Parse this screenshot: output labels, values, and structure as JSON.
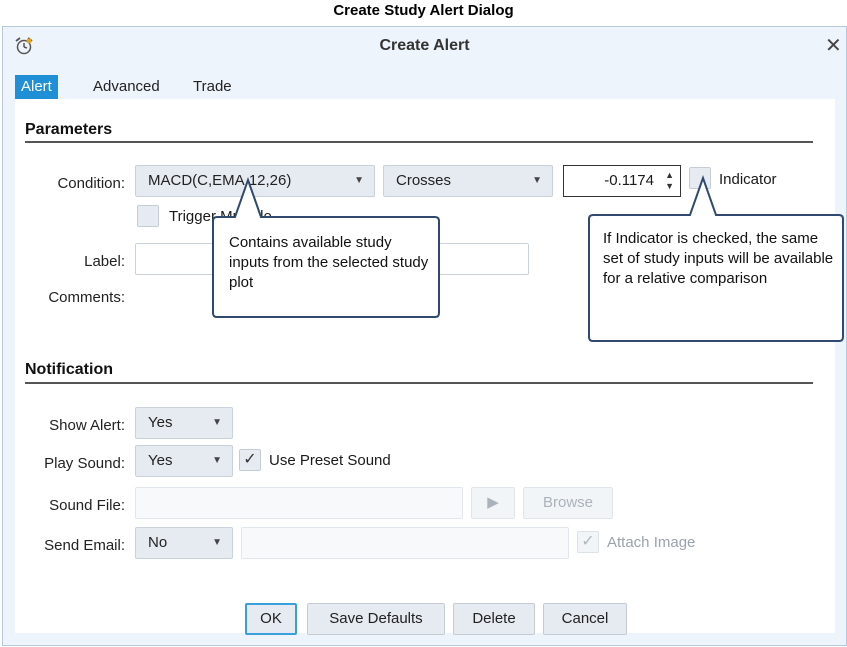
{
  "caption": "Create Study Alert Dialog",
  "window": {
    "title": "Create Alert",
    "close_glyph": "✕",
    "icon": "alarm-clock-icon"
  },
  "tabs": [
    {
      "label": "Alert",
      "active": true
    },
    {
      "label": "Advanced",
      "active": false
    },
    {
      "label": "Trade",
      "active": false
    }
  ],
  "parameters": {
    "heading": "Parameters",
    "condition_label": "Condition:",
    "condition_value": "MACD(C,EMA,12,26)",
    "operator_value": "Crosses",
    "threshold_value": "-0.1174",
    "indicator_label": "Indicator",
    "indicator_checked": false,
    "trigger_multiple_label": "Trigger Multiple",
    "label_label": "Label:",
    "label_value": "",
    "comments_label": "Comments:",
    "comments_value": ""
  },
  "callouts": {
    "left": "Contains available study inputs from the selected study plot",
    "right": "If Indicator is checked, the same set of study inputs will be available for a relative comparison"
  },
  "notification": {
    "heading": "Notification",
    "show_alert_label": "Show Alert:",
    "show_alert_value": "Yes",
    "play_sound_label": "Play Sound:",
    "play_sound_value": "Yes",
    "use_preset_label": "Use Preset Sound",
    "use_preset_checked": true,
    "sound_file_label": "Sound File:",
    "sound_file_value": "",
    "play_glyph": "▶",
    "browse_label": "Browse",
    "send_email_label": "Send Email:",
    "send_email_value": "No",
    "email_value": "",
    "attach_image_label": "Attach Image",
    "attach_image_checked": true
  },
  "buttons": {
    "ok": "OK",
    "save_defaults": "Save Defaults",
    "delete": "Delete",
    "cancel": "Cancel"
  },
  "colors": {
    "accent": "#1f8fd6",
    "dialog_bg": "#eef4fb",
    "callout_border": "#2f4a6e"
  }
}
